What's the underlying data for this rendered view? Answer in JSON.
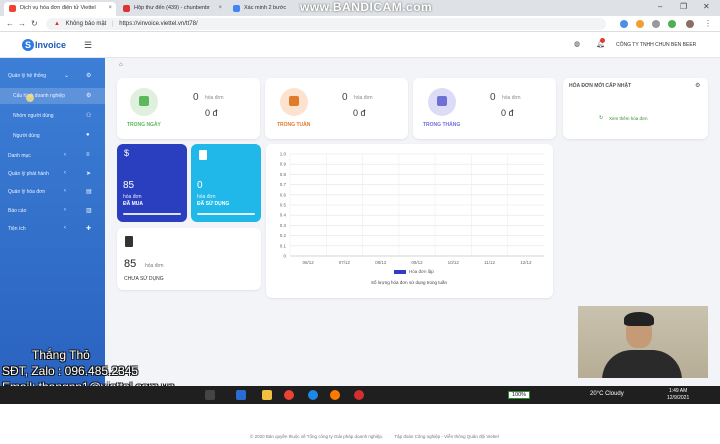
{
  "browser": {
    "tabs": [
      {
        "title": "Dịch vụ hóa đơn điện tử Viettel",
        "active": true
      },
      {
        "title": "Hộp thư đến (439) - chunbenbr",
        "active": false
      },
      {
        "title": "Xác minh 2 bước",
        "active": false
      }
    ],
    "recorder": "www.BANDICAM.com",
    "security_label": "Không bảo mật",
    "url": "https://vinvoice.viettel.vn/tt78/"
  },
  "app": {
    "logo_text": "Invoice",
    "company": "CÔNG TY TNHH CHUN BEN BEER"
  },
  "sidebar": {
    "items": [
      {
        "label": "Quản lý hệ thống",
        "arrow": "⌄"
      },
      {
        "label": "Cấu hình doanh nghiệp"
      },
      {
        "label": "Nhóm người dùng"
      },
      {
        "label": "Người dùng"
      },
      {
        "label": "Danh mục",
        "arrow": "‹"
      },
      {
        "label": "Quản lý phát hành",
        "arrow": "‹"
      },
      {
        "label": "Quản lý hóa đơn",
        "arrow": "‹"
      },
      {
        "label": "Báo cáo",
        "arrow": "‹"
      },
      {
        "label": "Tiện ích",
        "arrow": "‹"
      }
    ]
  },
  "breadcrumb_icon": "home-icon",
  "stats": [
    {
      "label": "TRONG NGÀY",
      "count": "0",
      "unit": "hóa đơn",
      "money": "0 đ",
      "color": "#5cb85c",
      "bg": "#dff0df"
    },
    {
      "label": "TRONG TUẦN",
      "count": "0",
      "unit": "hóa đơn",
      "money": "0 đ",
      "color": "#e07b2b",
      "bg": "#fde3cf"
    },
    {
      "label": "TRONG THÁNG",
      "count": "0",
      "unit": "hóa đơn",
      "money": "0 đ",
      "color": "#6f6fd6",
      "bg": "#dcdcf7"
    }
  ],
  "latest": {
    "title": "HÓA ĐƠN MỚI CẤP NHẬT",
    "link": "Xem thêm hóa đơn"
  },
  "summary": {
    "purchased": {
      "count": "85",
      "unit": "hóa đơn",
      "label": "ĐÃ MUA"
    },
    "used": {
      "count": "0",
      "unit": "hóa đơn",
      "label": "ĐÃ SỬ DỤNG"
    },
    "unused": {
      "count": "85",
      "unit": "hóa đơn",
      "label": "CHƯA SỬ DỤNG"
    }
  },
  "chart_data": {
    "type": "bar",
    "categories": [
      "06/12",
      "07/12",
      "08/12",
      "09/12",
      "10/12",
      "11/12",
      "12/12"
    ],
    "series": [
      {
        "name": "Hóa đơn lập",
        "values": [
          0,
          0,
          0,
          0,
          0,
          0,
          0
        ]
      }
    ],
    "yticks": [
      "1.0",
      "0.9",
      "0.8",
      "0.7",
      "0.6",
      "0.5",
      "0.4",
      "0.3",
      "0.2",
      "0.1",
      "0"
    ],
    "ylim": [
      0,
      1
    ],
    "title": "Số lượng hóa đơn sử dụng trong tuần",
    "legend": "bottom",
    "grid": true,
    "bar_color": "#2b3fc4"
  },
  "footer": {
    "left": "© 2020 Bản quyền thuộc về Tổng công ty Giải pháp doanh nghiệp.",
    "right": "Tập đoàn Công nghiệp - Viễn thông Quân đội Viettel"
  },
  "overlay": {
    "name": "Thắng Thỏ",
    "phone": "SĐT, Zalo : 096.485.2345",
    "email": "Email: thangnp1@viettel.com.vn"
  },
  "taskbar": {
    "battery": "100%",
    "weather": "20°C Cloudy",
    "time": "1:49 AM",
    "date": "12/9/2021"
  }
}
